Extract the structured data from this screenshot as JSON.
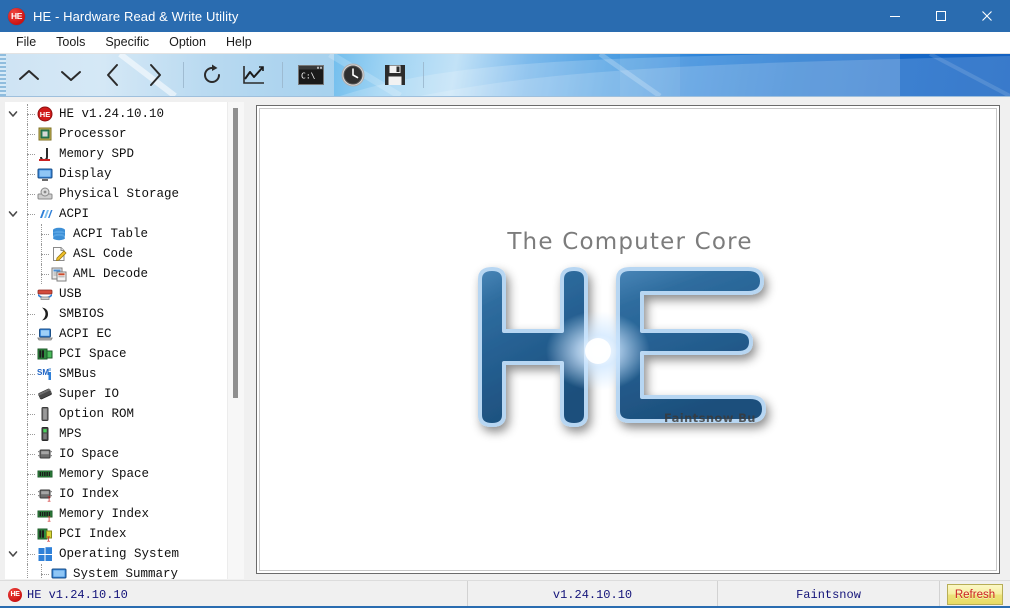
{
  "window": {
    "title": "HE - Hardware Read & Write Utility",
    "logo_text": "HE",
    "logo_icon": "he-circle-icon",
    "minimize_icon": "minimize-icon",
    "maximize_icon": "maximize-icon",
    "close_icon": "close-icon",
    "titlebar_color": "#2a6cb0"
  },
  "menu": {
    "items": [
      {
        "label": "File"
      },
      {
        "label": "Tools"
      },
      {
        "label": "Specific"
      },
      {
        "label": "Option"
      },
      {
        "label": "Help"
      }
    ]
  },
  "toolbar": {
    "buttons": [
      {
        "name": "chevron-up-icon",
        "label": "Up"
      },
      {
        "name": "chevron-down-icon",
        "label": "Down"
      },
      {
        "name": "chevron-left-icon",
        "label": "Back"
      },
      {
        "name": "chevron-right-icon",
        "label": "Forward"
      },
      {
        "name": "refresh-icon",
        "label": "Refresh"
      },
      {
        "name": "chart-icon",
        "label": "Chart"
      },
      {
        "name": "console-icon",
        "label": "Console"
      },
      {
        "name": "clock-icon",
        "label": "Clock"
      },
      {
        "name": "save-icon",
        "label": "Save"
      }
    ],
    "console_text": "C:\\"
  },
  "tree": {
    "items": [
      {
        "label": "HE v1.24.10.10",
        "icon": "he-circle-icon",
        "depth": 0,
        "expanded": true,
        "selected": false
      },
      {
        "label": "Processor",
        "icon": "processor-icon",
        "depth": 1,
        "expanded": null,
        "selected": false
      },
      {
        "label": "Memory SPD",
        "icon": "memory-spd-icon",
        "depth": 1,
        "expanded": null,
        "selected": false
      },
      {
        "label": "Display",
        "icon": "display-icon",
        "depth": 1,
        "expanded": null,
        "selected": false
      },
      {
        "label": "Physical Storage",
        "icon": "storage-icon",
        "depth": 1,
        "expanded": null,
        "selected": false
      },
      {
        "label": "ACPI",
        "icon": "acpi-icon",
        "depth": 1,
        "expanded": true,
        "selected": false
      },
      {
        "label": "ACPI Table",
        "icon": "acpi-table-icon",
        "depth": 2,
        "expanded": null,
        "selected": false
      },
      {
        "label": "ASL Code",
        "icon": "asl-code-icon",
        "depth": 2,
        "expanded": null,
        "selected": false
      },
      {
        "label": "AML Decode",
        "icon": "aml-decode-icon",
        "depth": 2,
        "expanded": null,
        "selected": false
      },
      {
        "label": "USB",
        "icon": "usb-icon",
        "depth": 1,
        "expanded": null,
        "selected": false
      },
      {
        "label": "SMBIOS",
        "icon": "smbios-icon",
        "depth": 1,
        "expanded": null,
        "selected": false
      },
      {
        "label": "ACPI EC",
        "icon": "acpi-ec-icon",
        "depth": 1,
        "expanded": null,
        "selected": false
      },
      {
        "label": "PCI Space",
        "icon": "pci-space-icon",
        "depth": 1,
        "expanded": null,
        "selected": false
      },
      {
        "label": "SMBus",
        "icon": "smbus-icon",
        "depth": 1,
        "expanded": null,
        "selected": false
      },
      {
        "label": "Super IO",
        "icon": "super-io-icon",
        "depth": 1,
        "expanded": null,
        "selected": false
      },
      {
        "label": "Option ROM",
        "icon": "option-rom-icon",
        "depth": 1,
        "expanded": null,
        "selected": false
      },
      {
        "label": "MPS",
        "icon": "mps-icon",
        "depth": 1,
        "expanded": null,
        "selected": false
      },
      {
        "label": "IO Space",
        "icon": "io-space-icon",
        "depth": 1,
        "expanded": null,
        "selected": false
      },
      {
        "label": "Memory Space",
        "icon": "memory-space-icon",
        "depth": 1,
        "expanded": null,
        "selected": false
      },
      {
        "label": "IO Index",
        "icon": "io-index-icon",
        "depth": 1,
        "expanded": null,
        "selected": false
      },
      {
        "label": "Memory Index",
        "icon": "memory-index-icon",
        "depth": 1,
        "expanded": null,
        "selected": false
      },
      {
        "label": "PCI Index",
        "icon": "pci-index-icon",
        "depth": 1,
        "expanded": null,
        "selected": false
      },
      {
        "label": "Operating System",
        "icon": "windows-icon",
        "depth": 1,
        "expanded": true,
        "selected": false
      },
      {
        "label": "System Summary",
        "icon": "system-summary-icon",
        "depth": 2,
        "expanded": null,
        "selected": false
      }
    ]
  },
  "content": {
    "tagline": "The Computer Core",
    "logo_letters": "HE",
    "watermark": "Faintsnow Bu"
  },
  "statusbar": {
    "app_label": "HE v1.24.10.10",
    "app_logo": "HE",
    "version": "v1.24.10.10",
    "author": "Faintsnow",
    "refresh_label": "Refresh"
  }
}
